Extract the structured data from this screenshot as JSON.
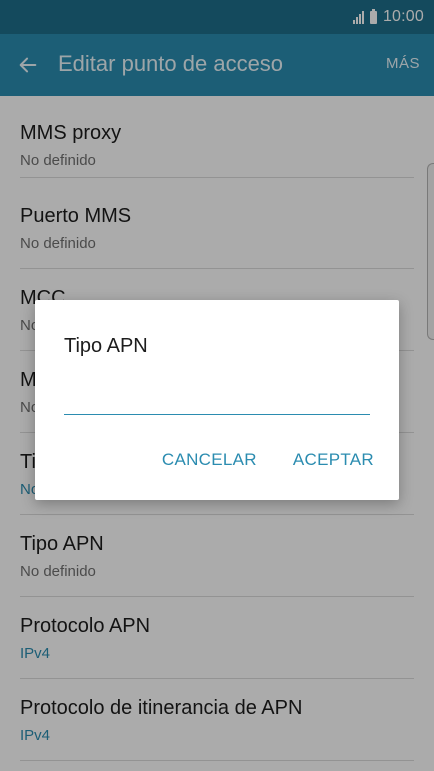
{
  "status_bar": {
    "time": "10:00",
    "icons": [
      "signal-icon",
      "battery-icon"
    ]
  },
  "app_bar": {
    "title": "Editar punto de acceso",
    "more_label": "MÁS",
    "back_icon": "arrow-left-icon"
  },
  "list": {
    "items": [
      {
        "title": "MMS proxy",
        "value": "No definido"
      },
      {
        "title": "Puerto MMS",
        "value": "No definido"
      },
      {
        "title": "MCC",
        "value": "No"
      },
      {
        "title": "M",
        "value": "No"
      },
      {
        "title": "Ti",
        "value": "No"
      },
      {
        "title": "Tipo APN",
        "value": "No definido"
      },
      {
        "title": "Protocolo APN",
        "value": "IPv4"
      },
      {
        "title": "Protocolo de itinerancia de APN",
        "value": "IPv4"
      }
    ]
  },
  "dialog": {
    "title": "Tipo APN",
    "input_value": "",
    "cancel_label": "CANCELAR",
    "accept_label": "ACEPTAR"
  },
  "colors": {
    "status_bar": "#1f6f8b",
    "app_bar": "#2b8cb0",
    "accent": "#2b8cb0"
  }
}
